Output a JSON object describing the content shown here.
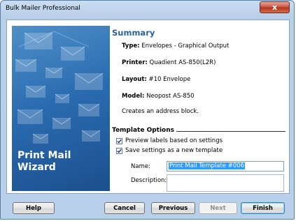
{
  "window": {
    "title": "Bulk Mailer Professional",
    "close_label": "x"
  },
  "banner": {
    "title_line1": "Print Mail",
    "title_line2": "Wizard"
  },
  "summary": {
    "heading": "Summary",
    "type_label": "Type:",
    "type_value": "Envelopes - Graphical Output",
    "printer_label": "Printer:",
    "printer_value": "Quadient AS-850(L2R)",
    "layout_label": "Layout:",
    "layout_value": "#10 Envelope",
    "model_label": "Model:",
    "model_value": "Neopost AS-850",
    "note": "Creates an address block."
  },
  "template_options": {
    "heading": "Template Options",
    "preview_label": "Preview labels based on settings",
    "preview_checked": true,
    "save_label": "Save settings as a new template",
    "save_checked": true,
    "name_label": "Name:",
    "name_value": "Print Mail Template  #006",
    "description_label": "Description:",
    "description_value": ""
  },
  "buttons": {
    "help": "Help",
    "cancel": "Cancel",
    "previous": "Previous",
    "next": "Next",
    "finish": "Finish"
  }
}
